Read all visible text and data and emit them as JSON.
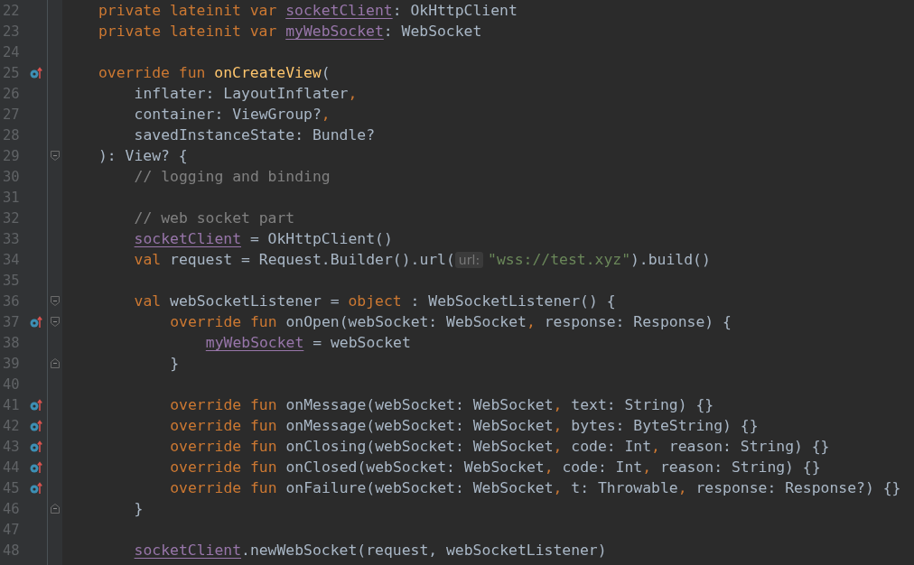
{
  "editor": {
    "lines": [
      {
        "number": "22",
        "tokens": [
          {
            "kind": "keyword",
            "text": "private lateinit var "
          },
          {
            "kind": "property",
            "text": "socketClient"
          },
          {
            "kind": "plain",
            "text": ": OkHttpClient"
          }
        ]
      },
      {
        "number": "23",
        "tokens": [
          {
            "kind": "keyword",
            "text": "private lateinit var "
          },
          {
            "kind": "property",
            "text": "myWebSocket"
          },
          {
            "kind": "plain",
            "text": ": WebSocket"
          }
        ]
      },
      {
        "number": "24"
      },
      {
        "number": "25",
        "override_marker": true,
        "tokens": [
          {
            "kind": "keyword",
            "text": "override fun "
          },
          {
            "kind": "function",
            "text": "onCreateView"
          },
          {
            "kind": "plain",
            "text": "("
          }
        ],
        "children": [
          {
            "number": "26",
            "tokens": [
              {
                "kind": "plain",
                "text": "inflater: LayoutInflater"
              },
              {
                "kind": "keyword",
                "text": ","
              }
            ]
          },
          {
            "number": "27",
            "tokens": [
              {
                "kind": "plain",
                "text": "container: ViewGroup?"
              },
              {
                "kind": "keyword",
                "text": ","
              }
            ]
          },
          {
            "number": "28",
            "tokens": [
              {
                "kind": "plain",
                "text": "savedInstanceState: Bundle?"
              }
            ]
          }
        ]
      },
      {
        "number": "29",
        "fold_start": true,
        "tokens": [
          {
            "kind": "plain",
            "text": "): View? {"
          }
        ],
        "children": [
          {
            "number": "30",
            "tokens": [
              {
                "kind": "comment",
                "text": "// logging and binding"
              }
            ]
          },
          {
            "number": "31"
          },
          {
            "number": "32",
            "tokens": [
              {
                "kind": "comment",
                "text": "// web socket part"
              }
            ]
          },
          {
            "number": "33",
            "tokens": [
              {
                "kind": "property",
                "text": "socketClient"
              },
              {
                "kind": "plain",
                "text": " = OkHttpClient()"
              }
            ]
          },
          {
            "number": "34",
            "tokens": [
              {
                "kind": "keyword",
                "text": "val "
              },
              {
                "kind": "plain",
                "text": "request = Request.Builder().url("
              },
              {
                "kind": "hint",
                "text": "url:"
              },
              {
                "kind": "string",
                "text": "\"wss://test.xyz\""
              },
              {
                "kind": "plain",
                "text": ").build()"
              }
            ]
          },
          {
            "number": "35"
          },
          {
            "number": "36",
            "fold_start": true,
            "tokens": [
              {
                "kind": "keyword",
                "text": "val "
              },
              {
                "kind": "plain",
                "text": "webSocketListener = "
              },
              {
                "kind": "keyword",
                "text": "object "
              },
              {
                "kind": "plain",
                "text": ": WebSocketListener() {"
              }
            ],
            "children": [
              {
                "number": "37",
                "override_marker": true,
                "fold_start": true,
                "tokens": [
                  {
                    "kind": "keyword",
                    "text": "override fun "
                  },
                  {
                    "kind": "plain",
                    "text": "onOpen(webSocket: WebSocket"
                  },
                  {
                    "kind": "keyword",
                    "text": ", "
                  },
                  {
                    "kind": "plain",
                    "text": "response: Response) {"
                  }
                ],
                "children": [
                  {
                    "number": "38",
                    "tokens": [
                      {
                        "kind": "property",
                        "text": "myWebSocket"
                      },
                      {
                        "kind": "plain",
                        "text": " = webSocket"
                      }
                    ]
                  }
                ]
              },
              {
                "number": "39",
                "fold_end": true,
                "tokens": [
                  {
                    "kind": "plain",
                    "text": "}"
                  }
                ]
              },
              {
                "number": "40"
              },
              {
                "number": "41",
                "override_marker": true,
                "tokens": [
                  {
                    "kind": "keyword",
                    "text": "override fun "
                  },
                  {
                    "kind": "plain",
                    "text": "onMessage(webSocket: WebSocket"
                  },
                  {
                    "kind": "keyword",
                    "text": ", "
                  },
                  {
                    "kind": "plain",
                    "text": "text: String) {}"
                  }
                ]
              },
              {
                "number": "42",
                "override_marker": true,
                "tokens": [
                  {
                    "kind": "keyword",
                    "text": "override fun "
                  },
                  {
                    "kind": "plain",
                    "text": "onMessage(webSocket: WebSocket"
                  },
                  {
                    "kind": "keyword",
                    "text": ", "
                  },
                  {
                    "kind": "plain",
                    "text": "bytes: ByteString) {}"
                  }
                ]
              },
              {
                "number": "43",
                "override_marker": true,
                "tokens": [
                  {
                    "kind": "keyword",
                    "text": "override fun "
                  },
                  {
                    "kind": "plain",
                    "text": "onClosing(webSocket: WebSocket"
                  },
                  {
                    "kind": "keyword",
                    "text": ", "
                  },
                  {
                    "kind": "plain",
                    "text": "code: Int"
                  },
                  {
                    "kind": "keyword",
                    "text": ", "
                  },
                  {
                    "kind": "plain",
                    "text": "reason: String) {}"
                  }
                ]
              },
              {
                "number": "44",
                "override_marker": true,
                "tokens": [
                  {
                    "kind": "keyword",
                    "text": "override fun "
                  },
                  {
                    "kind": "plain",
                    "text": "onClosed(webSocket: WebSocket"
                  },
                  {
                    "kind": "keyword",
                    "text": ", "
                  },
                  {
                    "kind": "plain",
                    "text": "code: Int"
                  },
                  {
                    "kind": "keyword",
                    "text": ", "
                  },
                  {
                    "kind": "plain",
                    "text": "reason: String) {}"
                  }
                ]
              },
              {
                "number": "45",
                "override_marker": true,
                "tokens": [
                  {
                    "kind": "keyword",
                    "text": "override fun "
                  },
                  {
                    "kind": "plain",
                    "text": "onFailure(webSocket: WebSocket"
                  },
                  {
                    "kind": "keyword",
                    "text": ", "
                  },
                  {
                    "kind": "plain",
                    "text": "t: Throwable"
                  },
                  {
                    "kind": "keyword",
                    "text": ", "
                  },
                  {
                    "kind": "plain",
                    "text": "response: Response?) {}"
                  }
                ]
              }
            ]
          },
          {
            "number": "46",
            "fold_end": true,
            "tokens": [
              {
                "kind": "plain",
                "text": "}"
              }
            ]
          },
          {
            "number": "47"
          },
          {
            "number": "48",
            "tokens": [
              {
                "kind": "property",
                "text": "socketClient"
              },
              {
                "kind": "plain",
                "text": ".newWebSocket(request, webSocketListener)"
              }
            ]
          }
        ]
      }
    ]
  }
}
